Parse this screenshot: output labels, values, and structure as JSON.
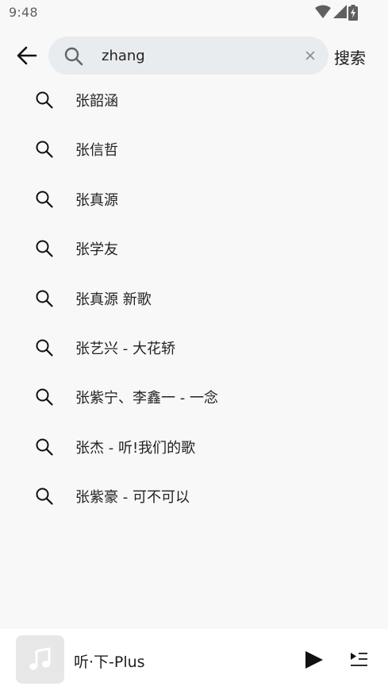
{
  "status_bar": {
    "time": "9:48",
    "icons": [
      "wifi-icon",
      "cellular-signal-icon",
      "battery-charging-icon"
    ]
  },
  "search": {
    "query": "zhang",
    "submit_label": "搜索"
  },
  "suggestions": [
    "张韶涵",
    "张信哲",
    "张真源",
    "张学友",
    "张真源 新歌",
    "张艺兴 - 大花轿",
    "张紫宁、李鑫一 - 一念",
    "张杰 - 听!我们的歌",
    "张紫豪 - 可不可以"
  ],
  "player": {
    "track_title": "听·下-Plus",
    "controls": [
      "play-icon",
      "queue-icon"
    ]
  },
  "colors": {
    "background": "#f8f8f8",
    "search_box": "#e9ecef",
    "player_bar": "#ffffff",
    "album_placeholder": "#e7e7e7"
  }
}
